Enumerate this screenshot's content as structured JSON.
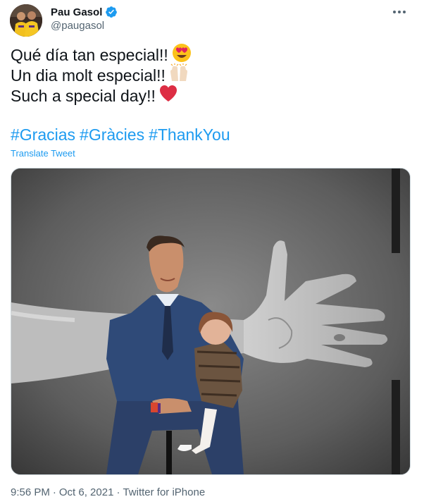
{
  "author": {
    "display_name": "Pau Gasol",
    "handle": "@paugasol",
    "verified": true
  },
  "tweet": {
    "lines": [
      {
        "text": "Qué día tan especial!!",
        "emoji": "heart-eyes-emoji"
      },
      {
        "text": "Un dia molt especial!!",
        "emoji": "raising-hands-emoji"
      },
      {
        "text": "Such a special day!!",
        "emoji": "red-heart-emoji"
      }
    ],
    "hashtags": [
      "#Gracias",
      "#Gràcies",
      "#ThankYou"
    ],
    "translate_label": "Translate Tweet"
  },
  "media": {
    "type": "photo"
  },
  "meta": {
    "time": "9:56 PM",
    "date": "Oct 6, 2021",
    "separator": "·",
    "source": "Twitter for iPhone"
  },
  "colors": {
    "accent": "#1d9bf0",
    "text": "#0f1419",
    "secondary": "#536471"
  }
}
